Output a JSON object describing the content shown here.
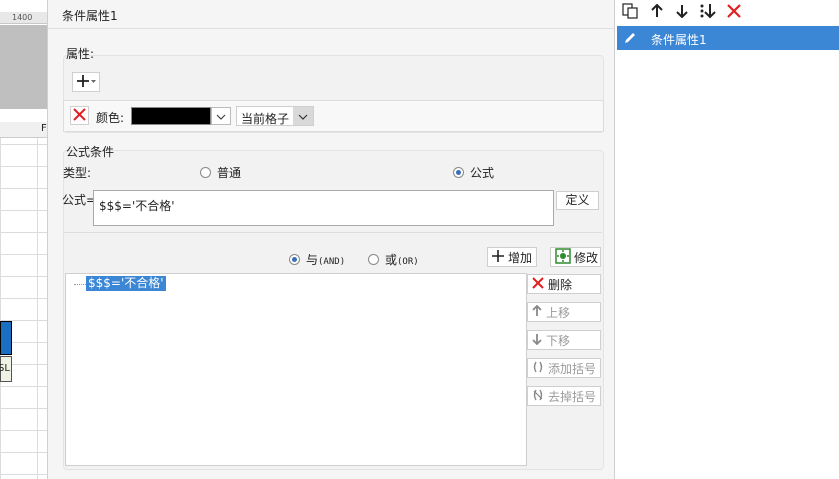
{
  "background_sheet": {
    "ruler_value": "1400",
    "column_header": "F",
    "cell_text": "SL"
  },
  "dialog": {
    "title": "条件属性1",
    "attributes": {
      "group_label": "属性:",
      "color_label": "颜色:",
      "color_value": "#000000",
      "scope_value": "当前格子"
    },
    "formula_condition": {
      "group_label": "公式条件",
      "type_label": "类型:",
      "type_options": [
        "普通",
        "公式"
      ],
      "selected_type": "公式",
      "formula_label": "公式=",
      "formula_value": "$$$='不合格'",
      "define_button": "定义",
      "logic_options": [
        "与",
        "或"
      ],
      "logic_tags": [
        "(AND)",
        "(OR)"
      ],
      "selected_logic": "与",
      "add_button": "增加",
      "modify_button": "修改",
      "conditions": [
        "$$$='不合格'"
      ],
      "side_buttons": {
        "delete": "删除",
        "move_up": "上移",
        "move_down": "下移",
        "add_paren": "添加括号",
        "remove_paren": "去掉括号"
      }
    }
  },
  "right_panel": {
    "items": [
      "条件属性1"
    ],
    "icons": [
      "copy-icon",
      "arrow-up-icon",
      "arrow-down-icon",
      "merge-down-icon",
      "delete-icon"
    ]
  }
}
